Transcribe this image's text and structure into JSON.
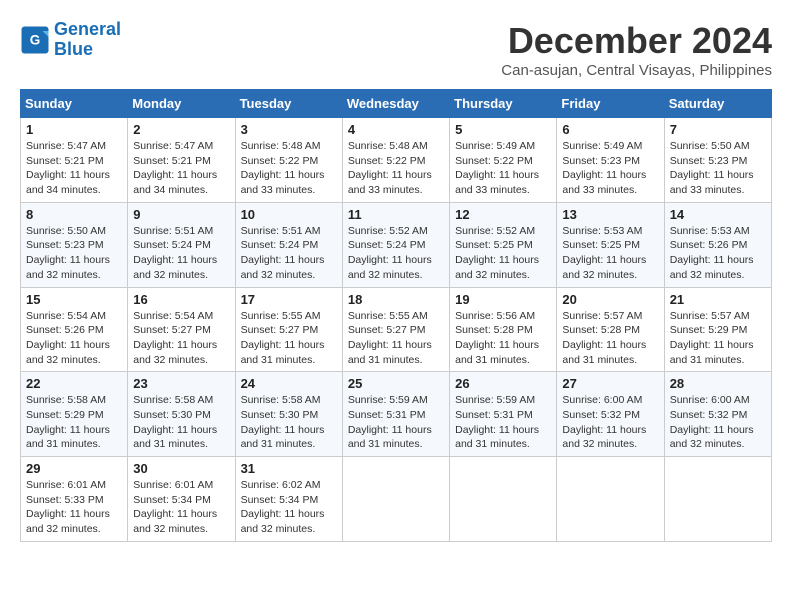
{
  "logo": {
    "line1": "General",
    "line2": "Blue"
  },
  "title": "December 2024",
  "location": "Can-asujan, Central Visayas, Philippines",
  "headers": [
    "Sunday",
    "Monday",
    "Tuesday",
    "Wednesday",
    "Thursday",
    "Friday",
    "Saturday"
  ],
  "weeks": [
    [
      {
        "day": "1",
        "sunrise": "5:47 AM",
        "sunset": "5:21 PM",
        "daylight": "11 hours and 34 minutes."
      },
      {
        "day": "2",
        "sunrise": "5:47 AM",
        "sunset": "5:21 PM",
        "daylight": "11 hours and 34 minutes."
      },
      {
        "day": "3",
        "sunrise": "5:48 AM",
        "sunset": "5:22 PM",
        "daylight": "11 hours and 33 minutes."
      },
      {
        "day": "4",
        "sunrise": "5:48 AM",
        "sunset": "5:22 PM",
        "daylight": "11 hours and 33 minutes."
      },
      {
        "day": "5",
        "sunrise": "5:49 AM",
        "sunset": "5:22 PM",
        "daylight": "11 hours and 33 minutes."
      },
      {
        "day": "6",
        "sunrise": "5:49 AM",
        "sunset": "5:23 PM",
        "daylight": "11 hours and 33 minutes."
      },
      {
        "day": "7",
        "sunrise": "5:50 AM",
        "sunset": "5:23 PM",
        "daylight": "11 hours and 33 minutes."
      }
    ],
    [
      {
        "day": "8",
        "sunrise": "5:50 AM",
        "sunset": "5:23 PM",
        "daylight": "11 hours and 32 minutes."
      },
      {
        "day": "9",
        "sunrise": "5:51 AM",
        "sunset": "5:24 PM",
        "daylight": "11 hours and 32 minutes."
      },
      {
        "day": "10",
        "sunrise": "5:51 AM",
        "sunset": "5:24 PM",
        "daylight": "11 hours and 32 minutes."
      },
      {
        "day": "11",
        "sunrise": "5:52 AM",
        "sunset": "5:24 PM",
        "daylight": "11 hours and 32 minutes."
      },
      {
        "day": "12",
        "sunrise": "5:52 AM",
        "sunset": "5:25 PM",
        "daylight": "11 hours and 32 minutes."
      },
      {
        "day": "13",
        "sunrise": "5:53 AM",
        "sunset": "5:25 PM",
        "daylight": "11 hours and 32 minutes."
      },
      {
        "day": "14",
        "sunrise": "5:53 AM",
        "sunset": "5:26 PM",
        "daylight": "11 hours and 32 minutes."
      }
    ],
    [
      {
        "day": "15",
        "sunrise": "5:54 AM",
        "sunset": "5:26 PM",
        "daylight": "11 hours and 32 minutes."
      },
      {
        "day": "16",
        "sunrise": "5:54 AM",
        "sunset": "5:27 PM",
        "daylight": "11 hours and 32 minutes."
      },
      {
        "day": "17",
        "sunrise": "5:55 AM",
        "sunset": "5:27 PM",
        "daylight": "11 hours and 31 minutes."
      },
      {
        "day": "18",
        "sunrise": "5:55 AM",
        "sunset": "5:27 PM",
        "daylight": "11 hours and 31 minutes."
      },
      {
        "day": "19",
        "sunrise": "5:56 AM",
        "sunset": "5:28 PM",
        "daylight": "11 hours and 31 minutes."
      },
      {
        "day": "20",
        "sunrise": "5:57 AM",
        "sunset": "5:28 PM",
        "daylight": "11 hours and 31 minutes."
      },
      {
        "day": "21",
        "sunrise": "5:57 AM",
        "sunset": "5:29 PM",
        "daylight": "11 hours and 31 minutes."
      }
    ],
    [
      {
        "day": "22",
        "sunrise": "5:58 AM",
        "sunset": "5:29 PM",
        "daylight": "11 hours and 31 minutes."
      },
      {
        "day": "23",
        "sunrise": "5:58 AM",
        "sunset": "5:30 PM",
        "daylight": "11 hours and 31 minutes."
      },
      {
        "day": "24",
        "sunrise": "5:58 AM",
        "sunset": "5:30 PM",
        "daylight": "11 hours and 31 minutes."
      },
      {
        "day": "25",
        "sunrise": "5:59 AM",
        "sunset": "5:31 PM",
        "daylight": "11 hours and 31 minutes."
      },
      {
        "day": "26",
        "sunrise": "5:59 AM",
        "sunset": "5:31 PM",
        "daylight": "11 hours and 31 minutes."
      },
      {
        "day": "27",
        "sunrise": "6:00 AM",
        "sunset": "5:32 PM",
        "daylight": "11 hours and 32 minutes."
      },
      {
        "day": "28",
        "sunrise": "6:00 AM",
        "sunset": "5:32 PM",
        "daylight": "11 hours and 32 minutes."
      }
    ],
    [
      {
        "day": "29",
        "sunrise": "6:01 AM",
        "sunset": "5:33 PM",
        "daylight": "11 hours and 32 minutes."
      },
      {
        "day": "30",
        "sunrise": "6:01 AM",
        "sunset": "5:34 PM",
        "daylight": "11 hours and 32 minutes."
      },
      {
        "day": "31",
        "sunrise": "6:02 AM",
        "sunset": "5:34 PM",
        "daylight": "11 hours and 32 minutes."
      },
      null,
      null,
      null,
      null
    ]
  ],
  "labels": {
    "sunrise": "Sunrise:",
    "sunset": "Sunset:",
    "daylight": "Daylight:"
  }
}
